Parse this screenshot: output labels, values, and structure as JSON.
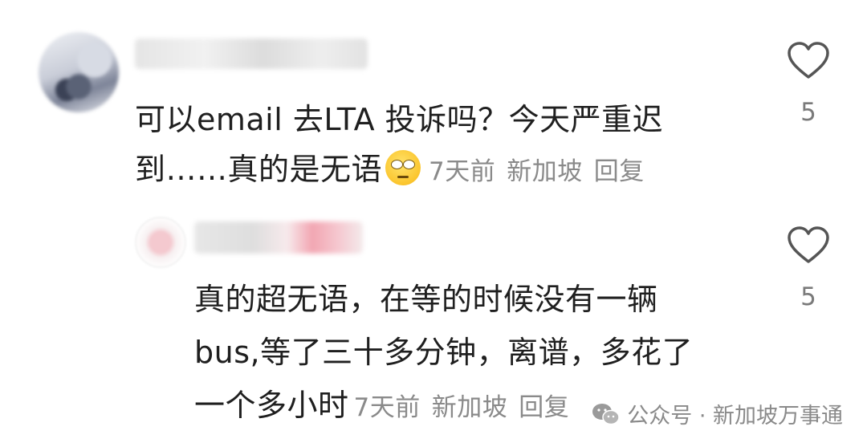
{
  "comments": [
    {
      "text_line1": "可以email 去LTA 投诉吗？今天严重迟",
      "text_line2": "到……真的是无语",
      "emoji": "rolling-eyes-face",
      "time": "7天前",
      "location": "新加坡",
      "reply_label": "回复",
      "likes": "5"
    },
    {
      "text_line1": "真的超无语，在等的时候没有一辆",
      "text_line2": "bus,等了三十多分钟，离谱，多花了",
      "text_line3": "一个多小时",
      "time": "7天前",
      "location": "新加坡",
      "reply_label": "回复",
      "likes": "5"
    }
  ],
  "watermark": {
    "text": "公众号 · 新加坡万事通",
    "icon": "wechat-icon"
  },
  "colors": {
    "text": "#1f1f1f",
    "meta": "#8a8a8a",
    "heart_stroke": "#555555"
  }
}
